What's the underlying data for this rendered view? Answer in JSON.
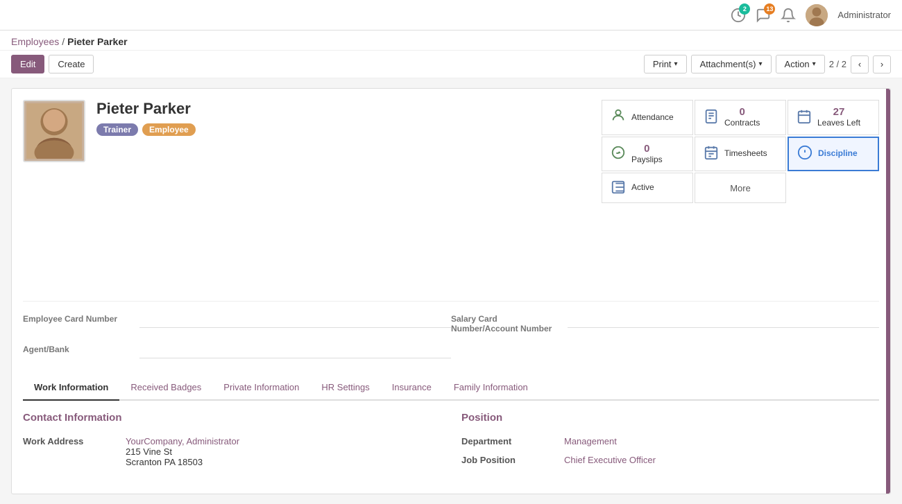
{
  "topnav": {
    "badge1_count": "2",
    "badge2_count": "13",
    "admin_label": "Administrator"
  },
  "breadcrumb": {
    "parent": "Employees",
    "separator": "/",
    "current": "Pieter Parker"
  },
  "toolbar": {
    "edit_label": "Edit",
    "create_label": "Create",
    "print_label": "Print",
    "attachments_label": "Attachment(s)",
    "action_label": "Action",
    "pagination": "2 / 2"
  },
  "employee": {
    "name": "Pieter Parker",
    "badges": [
      {
        "label": "Trainer",
        "type": "trainer"
      },
      {
        "label": "Employee",
        "type": "employee"
      }
    ],
    "fields": {
      "employee_card_label": "Employee Card Number",
      "employee_card_value": "",
      "salary_card_label": "Salary Card Number/Account Number",
      "salary_card_value": "",
      "agent_bank_label": "Agent/Bank",
      "agent_bank_value": ""
    }
  },
  "smart_buttons": [
    {
      "icon": "👤",
      "number": "",
      "label": "Attendance",
      "id": "attendance"
    },
    {
      "icon": "📋",
      "number": "0",
      "label": "Contracts",
      "id": "contracts"
    },
    {
      "icon": "🗓️",
      "number": "27",
      "label": "Leaves Left",
      "id": "leaves",
      "highlighted": true
    },
    {
      "icon": "💵",
      "number": "0",
      "label": "Payslips",
      "id": "payslips"
    },
    {
      "icon": "📅",
      "number": "",
      "label": "Timesheets",
      "id": "timesheets"
    },
    {
      "icon": "ℹ️",
      "number": "",
      "label": "Discipline",
      "id": "discipline",
      "selected": true
    },
    {
      "icon": "📊",
      "number": "",
      "label": "Active",
      "id": "active"
    },
    {
      "icon": "",
      "number": "",
      "label": "More",
      "id": "more"
    }
  ],
  "tabs": [
    {
      "label": "Work Information",
      "id": "work",
      "active": true
    },
    {
      "label": "Received Badges",
      "id": "badges"
    },
    {
      "label": "Private Information",
      "id": "private"
    },
    {
      "label": "HR Settings",
      "id": "hr"
    },
    {
      "label": "Insurance",
      "id": "insurance"
    },
    {
      "label": "Family Information",
      "id": "family"
    }
  ],
  "tab_work": {
    "contact_section": "Contact Information",
    "work_address_label": "Work Address",
    "work_address_line1": "YourCompany, Administrator",
    "work_address_line2": "215 Vine St",
    "work_address_line3": "Scranton PA 18503",
    "position_section": "Position",
    "department_label": "Department",
    "department_value": "Management",
    "job_position_label": "Job Position",
    "job_position_value": "Chief Executive Officer"
  }
}
